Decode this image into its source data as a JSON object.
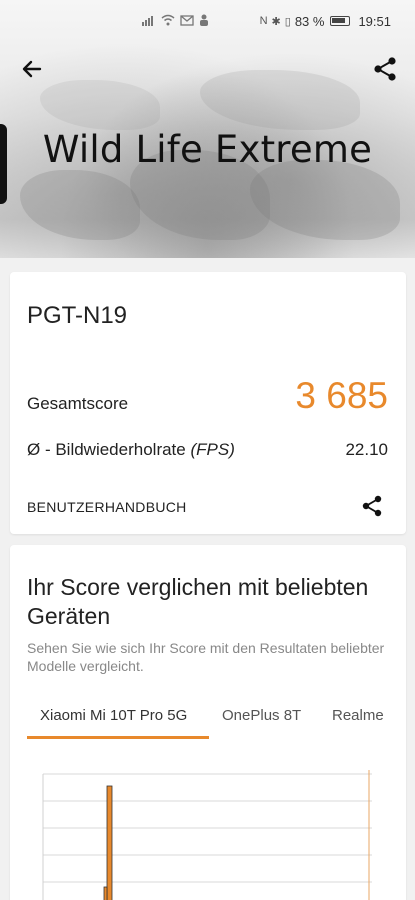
{
  "status_bar": {
    "battery_percent": "83 %",
    "time": "19:51"
  },
  "header": {
    "title": "Wild Life Extreme"
  },
  "result": {
    "device_name": "PGT-N19",
    "score_label": "Gesamtscore",
    "score_value": "3 685",
    "fps_label": "Ø - Bildwiederholrate",
    "fps_unit": "(FPS)",
    "fps_value": "22.10",
    "manual_link": "BENUTZERHANDBUCH"
  },
  "compare": {
    "title": "Ihr Score verglichen mit beliebten Geräten",
    "subtitle": "Sehen Sie wie sich Ihr Score mit den Resultaten beliebter Modelle vergleicht.",
    "tabs": [
      {
        "label": "Xiaomi Mi 10T Pro 5G",
        "active": true
      },
      {
        "label": "OnePlus 8T",
        "active": false
      },
      {
        "label": "Realme",
        "active": false
      }
    ]
  },
  "colors": {
    "accent": "#e8892c",
    "text": "#222222",
    "muted": "#888888"
  },
  "icons": {
    "back": "arrow-left-icon",
    "share": "share-icon"
  }
}
